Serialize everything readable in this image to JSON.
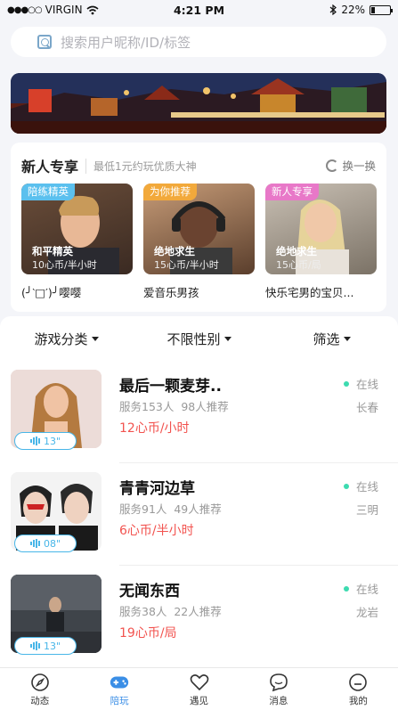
{
  "status_bar": {
    "carrier": "VIRGIN",
    "time": "4:21 PM",
    "battery": "22%",
    "battery_level": 0.22
  },
  "search": {
    "placeholder": "搜索用户昵称/ID/标签"
  },
  "featured": {
    "title": "新人专享",
    "subtitle": "最低1元约玩优质大神",
    "refresh_label": "换一换",
    "cards": [
      {
        "tag": "陪练精英",
        "tag_color": "#5bc0ee",
        "game": "和平精英",
        "price": "10心币/半小时",
        "name": "(╯‵□′)╯嘤嘤"
      },
      {
        "tag": "为你推荐",
        "tag_color": "#f2a93b",
        "game": "绝地求生",
        "price": "15心币/半小时",
        "name": "爱音乐男孩"
      },
      {
        "tag": "新人专享",
        "tag_color": "#e878c8",
        "game": "绝地求生",
        "price": "15心币/局",
        "name": "快乐宅男的宝贝..."
      }
    ]
  },
  "filters": [
    {
      "label": "游戏分类"
    },
    {
      "label": "不限性别"
    },
    {
      "label": "筛选"
    }
  ],
  "players": [
    {
      "name": "最后一颗麦芽..",
      "service": "服务153人",
      "recommend": "98人推荐",
      "price": "12心币/小时",
      "status": "在线",
      "city": "长春",
      "voice": "13\""
    },
    {
      "name": "青青河边草",
      "service": "服务91人",
      "recommend": "49人推荐",
      "price": "6心币/半小时",
      "status": "在线",
      "city": "三明",
      "voice": "08\""
    },
    {
      "name": "无闻东西",
      "service": "服务38人",
      "recommend": "22人推荐",
      "price": "19心币/局",
      "status": "在线",
      "city": "龙岩",
      "voice": "13\""
    }
  ],
  "tabbar": [
    {
      "label": "动态",
      "icon": "compass-icon"
    },
    {
      "label": "陪玩",
      "icon": "gamepad-icon",
      "active": true
    },
    {
      "label": "遇见",
      "icon": "heart-icon"
    },
    {
      "label": "消息",
      "icon": "chat-icon"
    },
    {
      "label": "我的",
      "icon": "profile-icon"
    }
  ],
  "colors": {
    "accent": "#3a8ee6",
    "price": "#f2534f",
    "online": "#3ddbb0",
    "voice": "#48b6e8"
  }
}
